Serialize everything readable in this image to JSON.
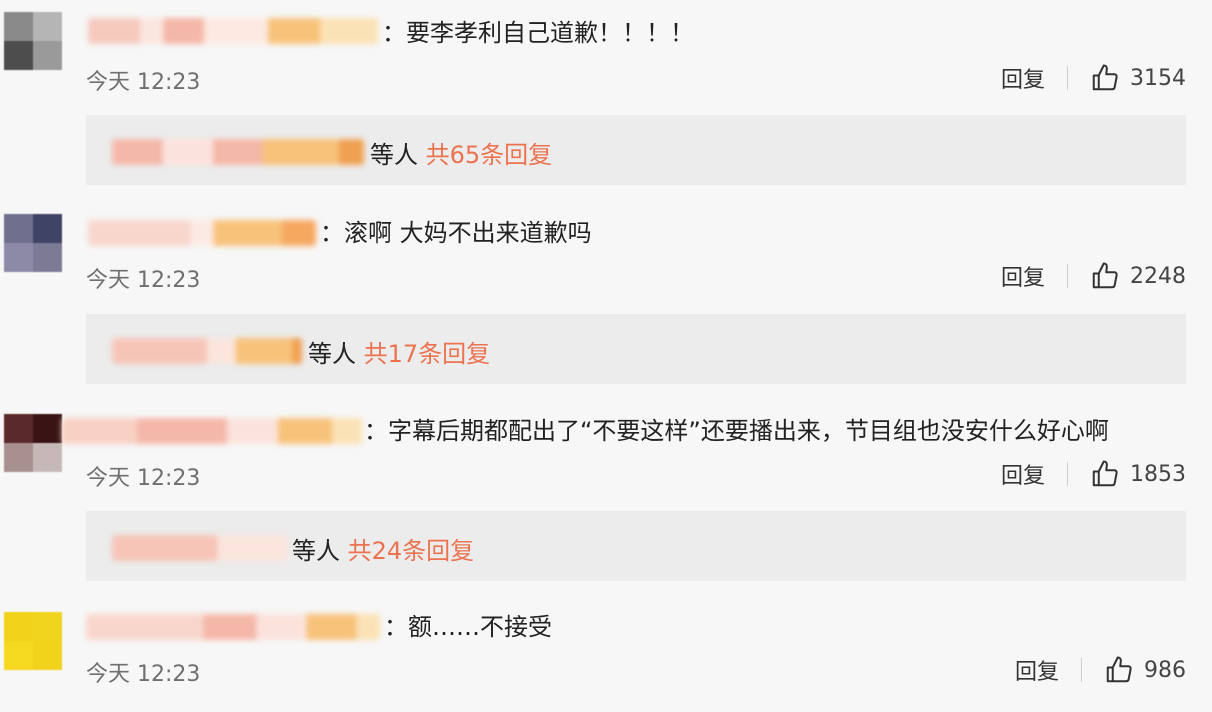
{
  "comments": [
    {
      "text": "：要李孝利自己道歉！！！！",
      "time": "今天 12:23",
      "reply_label": "回复",
      "like_count": "3154",
      "replies_suffix": "等人",
      "replies_total": "共65条回复",
      "avatar_colors": [
        "#8a8a8a",
        "#b5b5b5",
        "#4d4d4d",
        "#9a9a9a"
      ]
    },
    {
      "text": "：滚啊 大妈不出来道歉吗",
      "time": "今天 12:23",
      "reply_label": "回复",
      "like_count": "2248",
      "replies_suffix": "等人",
      "replies_total": "共17条回复",
      "avatar_colors": [
        "#6f6f8e",
        "#3f4466",
        "#8c8aa6",
        "#7d7a96"
      ]
    },
    {
      "text": "：字幕后期都配出了“不要这样”还要播出来，节目组也没安什么好心啊",
      "time": "今天 12:23",
      "reply_label": "回复",
      "like_count": "1853",
      "replies_suffix": "等人",
      "replies_total": "共24条回复",
      "avatar_colors": [
        "#5a2a2a",
        "#3a1414",
        "#a89090",
        "#c7b8b8"
      ]
    },
    {
      "text": "：额……不接受",
      "time": "今天 12:23",
      "reply_label": "回复",
      "like_count": "986",
      "avatar_colors": [
        "#f2d21a",
        "#f0d41e",
        "#f5d820",
        "#f2d31c"
      ]
    }
  ],
  "colors": {
    "background": "#f7f7f7",
    "reply_box": "#ececec",
    "reply_total": "#eb7350",
    "name_pink": "#f4b7a8",
    "name_orange": "#f7c27a"
  }
}
